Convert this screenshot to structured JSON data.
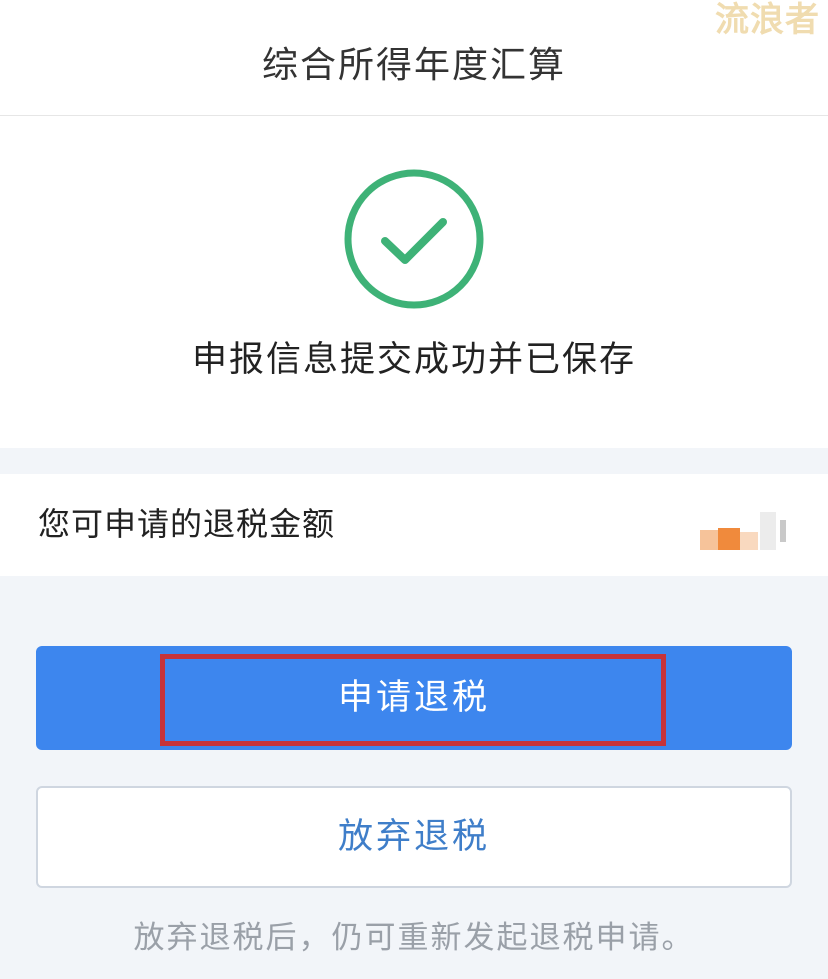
{
  "header": {
    "title": "综合所得年度汇算",
    "watermark": "流浪者"
  },
  "success": {
    "icon": "check-circle-icon",
    "message": "申报信息提交成功并已保存",
    "icon_color": "#3eb277"
  },
  "refund": {
    "label": "您可申请的退税金额",
    "value_obscured": true
  },
  "actions": {
    "apply_label": "申请退税",
    "abandon_label": "放弃退税"
  },
  "footnote": "放弃退税后，仍可重新发起退税申请。",
  "colors": {
    "primary": "#3d86ee",
    "highlight": "#c6333a",
    "success": "#3eb277",
    "secondary_text": "#3f7ec9"
  }
}
